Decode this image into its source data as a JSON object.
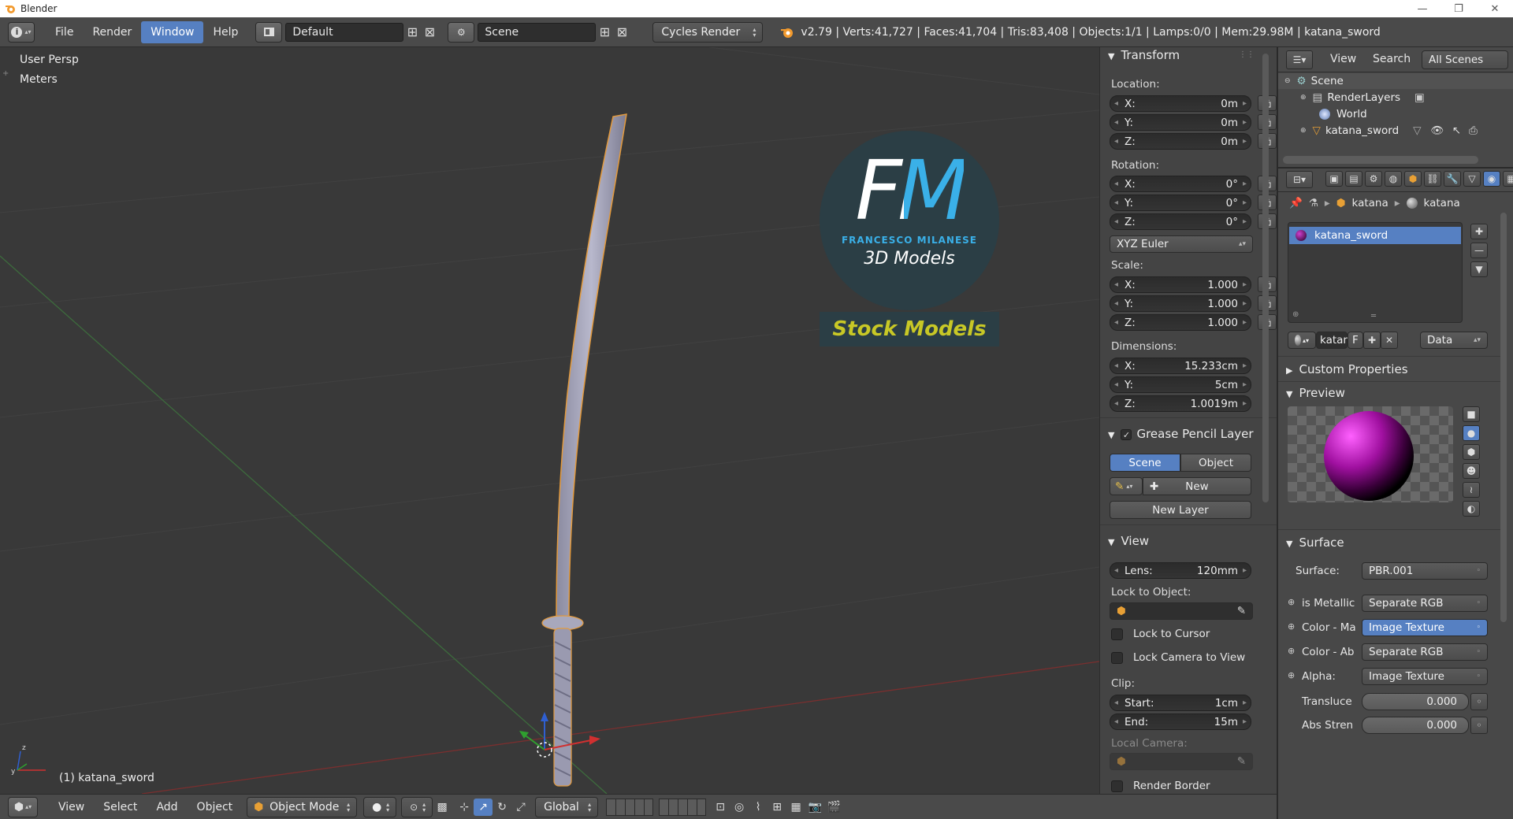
{
  "window": {
    "title": "Blender"
  },
  "topbar": {
    "menus": [
      "File",
      "Render",
      "Window",
      "Help"
    ],
    "active_menu": "Window",
    "layout": "Default",
    "scene": "Scene",
    "engine": "Cycles Render",
    "stats": "v2.79 | Verts:41,727 | Faces:41,704 | Tris:83,408 | Objects:1/1 | Lamps:0/0 | Mem:29.98M | katana_sword"
  },
  "viewport": {
    "view_name": "User Persp",
    "units": "Meters",
    "object_label": "(1) katana_sword",
    "watermark": {
      "line1": "FM",
      "line2": "FRANCESCO MILANESE",
      "line3": "3D Models",
      "badge": "Stock Models"
    }
  },
  "transform": {
    "title": "Transform",
    "location_label": "Location:",
    "location": [
      {
        "axis": "X:",
        "value": "0m"
      },
      {
        "axis": "Y:",
        "value": "0m"
      },
      {
        "axis": "Z:",
        "value": "0m"
      }
    ],
    "rotation_label": "Rotation:",
    "rotation": [
      {
        "axis": "X:",
        "value": "0°"
      },
      {
        "axis": "Y:",
        "value": "0°"
      },
      {
        "axis": "Z:",
        "value": "0°"
      }
    ],
    "rotation_mode": "XYZ Euler",
    "scale_label": "Scale:",
    "scale": [
      {
        "axis": "X:",
        "value": "1.000"
      },
      {
        "axis": "Y:",
        "value": "1.000"
      },
      {
        "axis": "Z:",
        "value": "1.000"
      }
    ],
    "dimensions_label": "Dimensions:",
    "dimensions": [
      {
        "axis": "X:",
        "value": "15.233cm"
      },
      {
        "axis": "Y:",
        "value": "5cm"
      },
      {
        "axis": "Z:",
        "value": "1.0019m"
      }
    ]
  },
  "grease_pencil": {
    "title": "Grease Pencil Layer",
    "tab_scene": "Scene",
    "tab_object": "Object",
    "new": "New",
    "new_layer": "New Layer"
  },
  "view_panel": {
    "title": "View",
    "lens_label": "Lens:",
    "lens_value": "120mm",
    "lock_object_label": "Lock to Object:",
    "lock_cursor": "Lock to Cursor",
    "lock_camera": "Lock Camera to View",
    "clip_label": "Clip:",
    "clip_start_label": "Start:",
    "clip_start": "1cm",
    "clip_end_label": "End:",
    "clip_end": "15m",
    "local_camera": "Local Camera:",
    "render_border": "Render Border"
  },
  "outliner": {
    "view": "View",
    "search": "Search",
    "filter": "All Scenes",
    "items": [
      "Scene",
      "RenderLayers",
      "World",
      "katana_sword"
    ]
  },
  "properties": {
    "breadcrumb": [
      "katana",
      "katana"
    ],
    "material_slot": "katana_sword",
    "mat_name": "katan",
    "mat_f": "F",
    "link": "Data",
    "custom_props": "Custom Properties",
    "preview": "Preview",
    "surface_title": "Surface",
    "surface_label": "Surface:",
    "surface_value": "PBR.001",
    "inputs": [
      {
        "label": "is Metallic",
        "value": "Separate RGB"
      },
      {
        "label": "Color - Ma",
        "value": "Image Texture"
      },
      {
        "label": "Color - Ab",
        "value": "Separate RGB"
      },
      {
        "label": "Alpha:",
        "value": "Image Texture"
      }
    ],
    "translucent_label": "Transluce",
    "translucent_value": "0.000",
    "abs_label": "Abs Stren",
    "abs_value": "0.000"
  },
  "bottombar": {
    "menus": [
      "View",
      "Select",
      "Add",
      "Object"
    ],
    "mode": "Object Mode",
    "orientation": "Global"
  },
  "colors": {
    "accent": "#5680c2",
    "header": "#4a4a4a",
    "viewport": "#393939",
    "panel": "#444444",
    "selection": "#f0a040"
  }
}
